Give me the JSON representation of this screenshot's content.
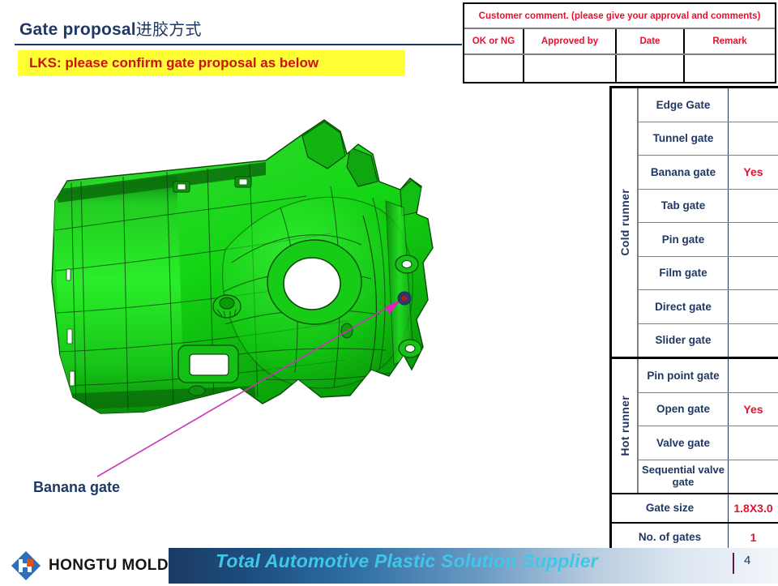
{
  "slide": {
    "title_en": "Gate proposal",
    "title_cn": "进胶方式",
    "note": "LKS: please confirm gate proposal as below",
    "page_number": "4"
  },
  "customer_comment": {
    "header": "Customer comment. (please give your approval and comments)",
    "columns": [
      "OK or NG",
      "Approved  by",
      "Date",
      "Remark"
    ],
    "values": [
      "",
      "",
      "",
      ""
    ]
  },
  "gate_table": {
    "groups": [
      {
        "runner": "Cold runner",
        "rows": [
          {
            "name": "Edge Gate",
            "value": ""
          },
          {
            "name": "Tunnel gate",
            "value": ""
          },
          {
            "name": "Banana gate",
            "value": "Yes"
          },
          {
            "name": "Tab gate",
            "value": ""
          },
          {
            "name": "Pin  gate",
            "value": ""
          },
          {
            "name": "Film  gate",
            "value": ""
          },
          {
            "name": "Direct  gate",
            "value": ""
          },
          {
            "name": "Slider gate",
            "value": ""
          }
        ]
      },
      {
        "runner": "Hot runner",
        "rows": [
          {
            "name": "Pin point gate",
            "value": ""
          },
          {
            "name": "Open gate",
            "value": "Yes"
          },
          {
            "name": "Valve gate",
            "value": ""
          },
          {
            "name": "Sequential valve gate",
            "value": ""
          }
        ]
      }
    ],
    "summary": [
      {
        "name": "Gate size",
        "value": "1.8X3.0"
      },
      {
        "name": "No. of gates",
        "value": "1"
      }
    ]
  },
  "callout": {
    "label": "Banana gate"
  },
  "footer": {
    "company": "HONGTU MOLD",
    "tagline": "Total Automotive Plastic Solution Supplier"
  },
  "colors": {
    "title_navy": "#1f3864",
    "note_red": "#d01010",
    "note_bg": "#ffff33",
    "table_red": "#e8112d",
    "model_green": "#22dd22",
    "leader_magenta": "#e020c0",
    "footer_cyan": "#3fc6e8"
  }
}
